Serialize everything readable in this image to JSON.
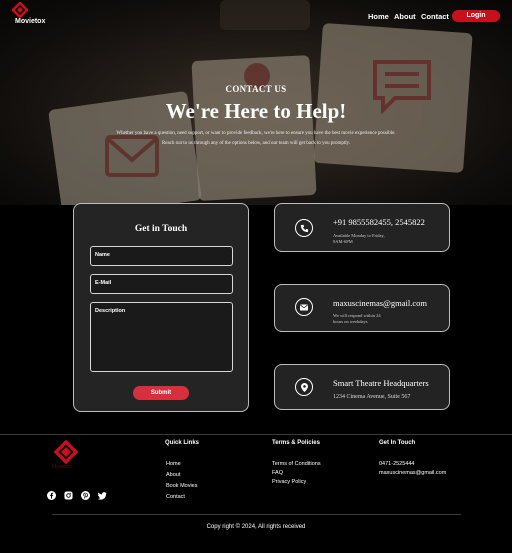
{
  "brand": {
    "name": "Movietox",
    "accent": "#c8101d"
  },
  "nav": {
    "links": [
      "Home",
      "About",
      "Contact"
    ],
    "login_label": "Login"
  },
  "hero": {
    "eyebrow": "CONTACT US",
    "title": "We're Here to Help!",
    "description_line1": "Whether you have a question, need support, or want to provide feedback, we're here to ensure you have the best movie experience possible.",
    "description_line2": "Reach out to us through any of the options below, and our team will get back to you promptly."
  },
  "form": {
    "title": "Get in Touch",
    "name_placeholder": "Name",
    "email_placeholder": "E-Mail",
    "description_placeholder": "Description",
    "submit_label": "Submit"
  },
  "contact_cards": [
    {
      "icon": "phone-icon",
      "main": "+91 9855582455, 2545822",
      "sub": [
        "Available Monday to Friday,",
        "9AM-6PM"
      ]
    },
    {
      "icon": "mail-icon",
      "main": "maxuscinemas@gmail.com",
      "sub": [
        "We will respond within 24",
        "hours on weekdays"
      ]
    },
    {
      "icon": "location-pin-icon",
      "main": "Smart Theatre Headquarters",
      "sub": [
        "1234 Cinema Avenue, Suite 567"
      ]
    }
  ],
  "footer": {
    "brand_name": "Movietox",
    "quick_links": {
      "heading": "Quick Links",
      "items": [
        "Home",
        "About",
        "Book Movies",
        "Contact"
      ]
    },
    "policies": {
      "heading": "Terms & Policies",
      "items": [
        "Terms of Conditions",
        "FAQ",
        "Privacy Policy"
      ]
    },
    "get_in_touch": {
      "heading": "Get In Touch",
      "items": [
        "0471-2525444",
        "maxuscinemas@gmail.com"
      ]
    },
    "social_icons": [
      "facebook-icon",
      "instagram-icon",
      "pinterest-icon",
      "twitter-icon"
    ],
    "copyright": "Copy right © 2024, All rights received"
  }
}
